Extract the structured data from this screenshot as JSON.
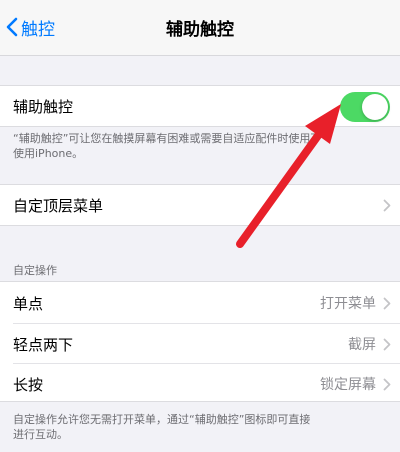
{
  "nav": {
    "back_label": "触控",
    "title": "辅助触控"
  },
  "assistive_touch": {
    "label": "辅助触控",
    "toggle_on": true,
    "toggle_color": "#4cd964",
    "footnote_line1": "“辅助触控”可让您在触摸屏幕有困难或需要自适应配件时使用",
    "footnote_line1_tail": "下",
    "footnote_line2": "使用iPhone。"
  },
  "top_menu": {
    "label": "自定顶层菜单"
  },
  "custom_actions": {
    "header": "自定操作",
    "rows": [
      {
        "label": "单点",
        "value": "打开菜单"
      },
      {
        "label": "轻点两下",
        "value": "截屏"
      },
      {
        "label": "长按",
        "value": "锁定屏幕"
      }
    ],
    "footnote_line1": "自定操作允许您无需打开菜单，通过“辅助触控”图标即可直接",
    "footnote_line2": "进行互动。"
  },
  "annotation": {
    "arrow_color": "#e8202a"
  }
}
